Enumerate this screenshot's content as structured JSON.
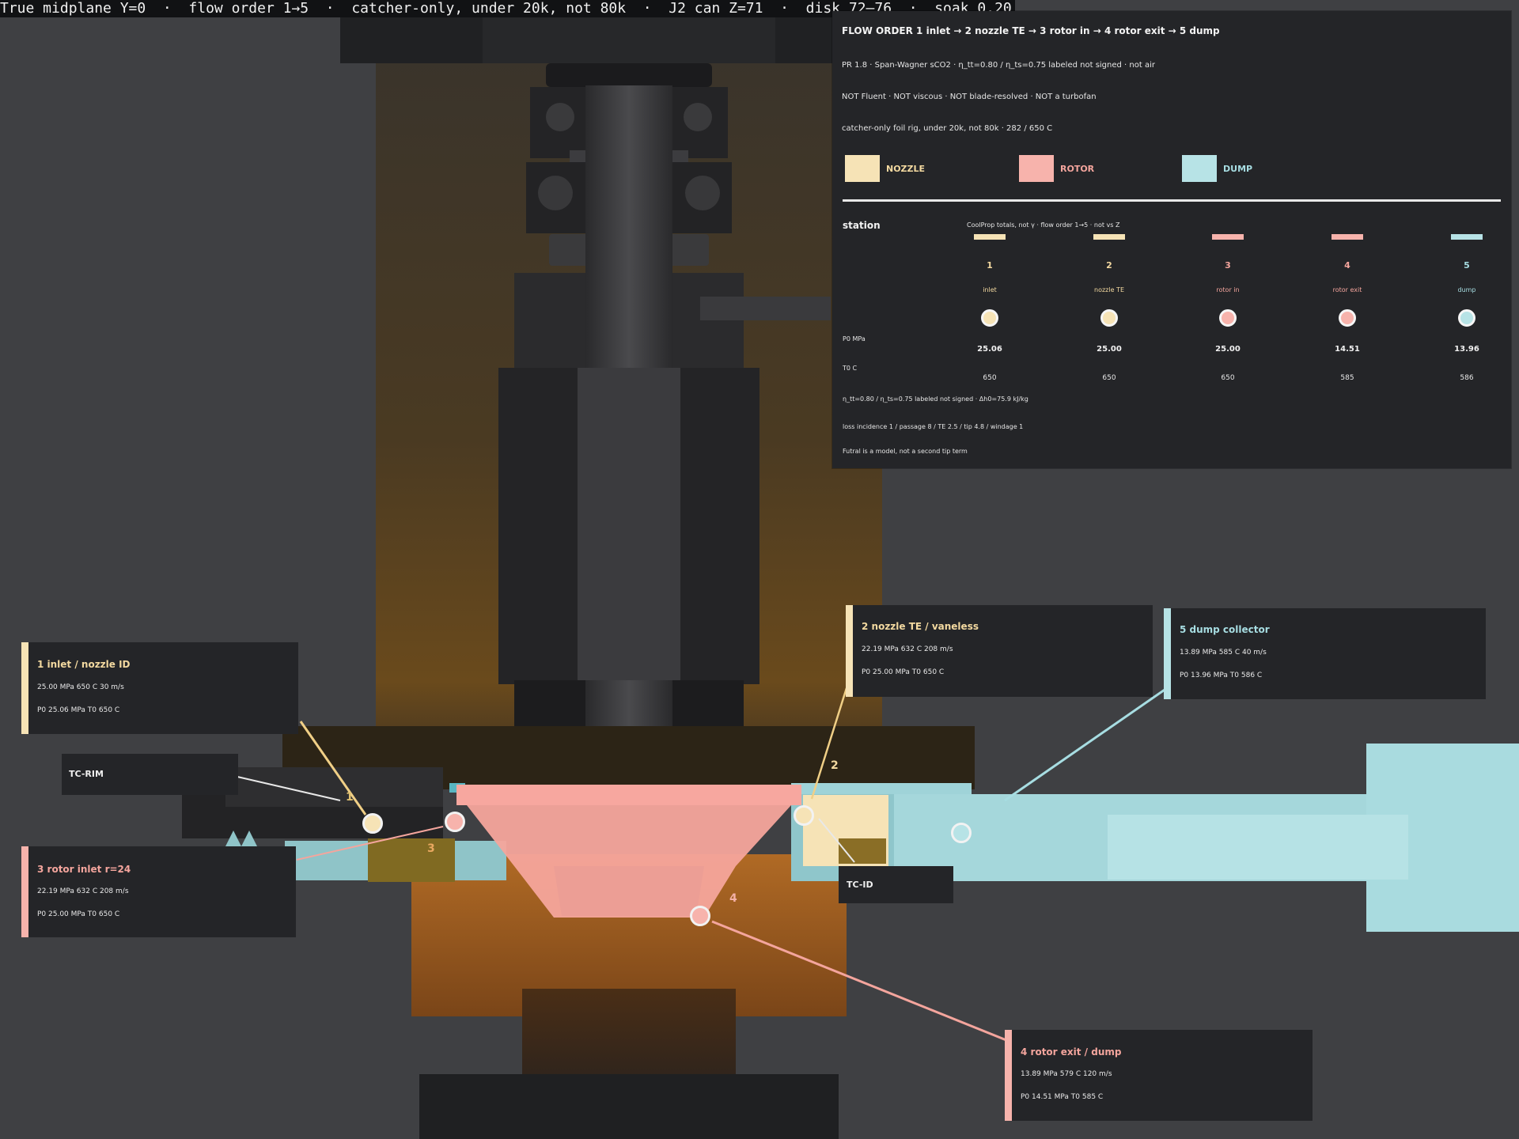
{
  "status_bar": "True midplane Y=0  ·  flow order 1→5  ·  catcher-only, under 20k, not 80k  ·  J2 can Z=71  ·  disk 72–76  ·  soak 0.20",
  "colors": {
    "nozzle": "#f6e3b6",
    "rotor": "#f7b3ac",
    "dump": "#b7e3e6",
    "background": "#3f4043",
    "panel": "#242528"
  },
  "legend_panel": {
    "title": "FLOW ORDER  1 inlet  →  2 nozzle TE  →  3 rotor in  →  4 rotor exit  →  5 dump",
    "lines": [
      "PR 1.8  ·  Span-Wagner sCO2  ·  η_tt=0.80 / η_ts=0.75 labeled not signed  ·  not air",
      "NOT Fluent  ·  NOT viscous  ·  NOT blade-resolved  ·  NOT a turbofan",
      "catcher-only foil rig, under 20k, not 80k  ·  282 / 650 C"
    ],
    "swatches": [
      {
        "label": "NOZZLE",
        "color": "#f6e3b6",
        "text_color": "#f3d9a0"
      },
      {
        "label": "ROTOR",
        "color": "#f7b3ac",
        "text_color": "#f4a59d"
      },
      {
        "label": "DUMP",
        "color": "#b7e3e6",
        "text_color": "#a7dde2"
      }
    ],
    "station_header": "station",
    "station_note": "CoolProp totals, not γ  ·  flow order 1→5  ·  not vs Z",
    "row_labels": [
      "P0 MPa",
      "T0 C"
    ],
    "stations": [
      {
        "num": "1",
        "name": "inlet",
        "color": "#f6e3b6",
        "text_color": "#f3d9a0",
        "p0": "25.06",
        "t0": "650"
      },
      {
        "num": "2",
        "name": "nozzle TE",
        "color": "#f6e3b6",
        "text_color": "#f3d9a0",
        "p0": "25.00",
        "t0": "650"
      },
      {
        "num": "3",
        "name": "rotor in",
        "color": "#f7b3ac",
        "text_color": "#f4a59d",
        "p0": "25.00",
        "t0": "650"
      },
      {
        "num": "4",
        "name": "rotor exit",
        "color": "#f7b3ac",
        "text_color": "#f4a59d",
        "p0": "14.51",
        "t0": "585"
      },
      {
        "num": "5",
        "name": "dump",
        "color": "#b7e3e6",
        "text_color": "#a7dde2",
        "p0": "13.96",
        "t0": "586"
      }
    ],
    "footer_lines": [
      "η_tt=0.80 / η_ts=0.75 labeled not signed  ·  Δh0=75.9 kJ/kg",
      "loss  incidence 1 / passage 8 / TE 2.5 / tip 4.8 / windage 1",
      "Futral is a model, not a second tip term"
    ]
  },
  "callouts": {
    "inlet": {
      "title": "1  inlet / nozzle ID",
      "line1": "25.00 MPa    650 C    30 m/s",
      "line2": "P0 25.06 MPa    T0 650 C",
      "color": "#f6e3b6",
      "text_color": "#f3d9a0"
    },
    "nozzle_te": {
      "title": "2  nozzle TE / vaneless",
      "line1": "22.19 MPa    632 C    208 m/s",
      "line2": "P0 25.00 MPa    T0 650 C",
      "color": "#f6e3b6",
      "text_color": "#f3d9a0"
    },
    "dump": {
      "title": "5  dump collector",
      "line1": "13.89 MPa    585 C    40 m/s",
      "line2": "P0 13.96 MPa    T0 586 C",
      "color": "#b7e3e6",
      "text_color": "#a7dde2"
    },
    "rotor_inlet": {
      "title": "3  rotor inlet r=24",
      "line1": "22.19 MPa    632 C    208 m/s",
      "line2": "P0 25.00 MPa    T0 650 C",
      "color": "#f7b3ac",
      "text_color": "#f4a59d"
    },
    "rotor_exit": {
      "title": "4  rotor exit / dump",
      "line1": "13.89 MPa    579 C    120 m/s",
      "line2": "P0 14.51 MPa    T0 585 C",
      "color": "#f7b3ac",
      "text_color": "#f4a59d"
    }
  },
  "tags": {
    "tc_rim": "TC-RIM",
    "tc_id": "TC-ID"
  },
  "scene_numbers": {
    "n1": "1",
    "n2": "2",
    "n3": "3",
    "n4": "4"
  }
}
